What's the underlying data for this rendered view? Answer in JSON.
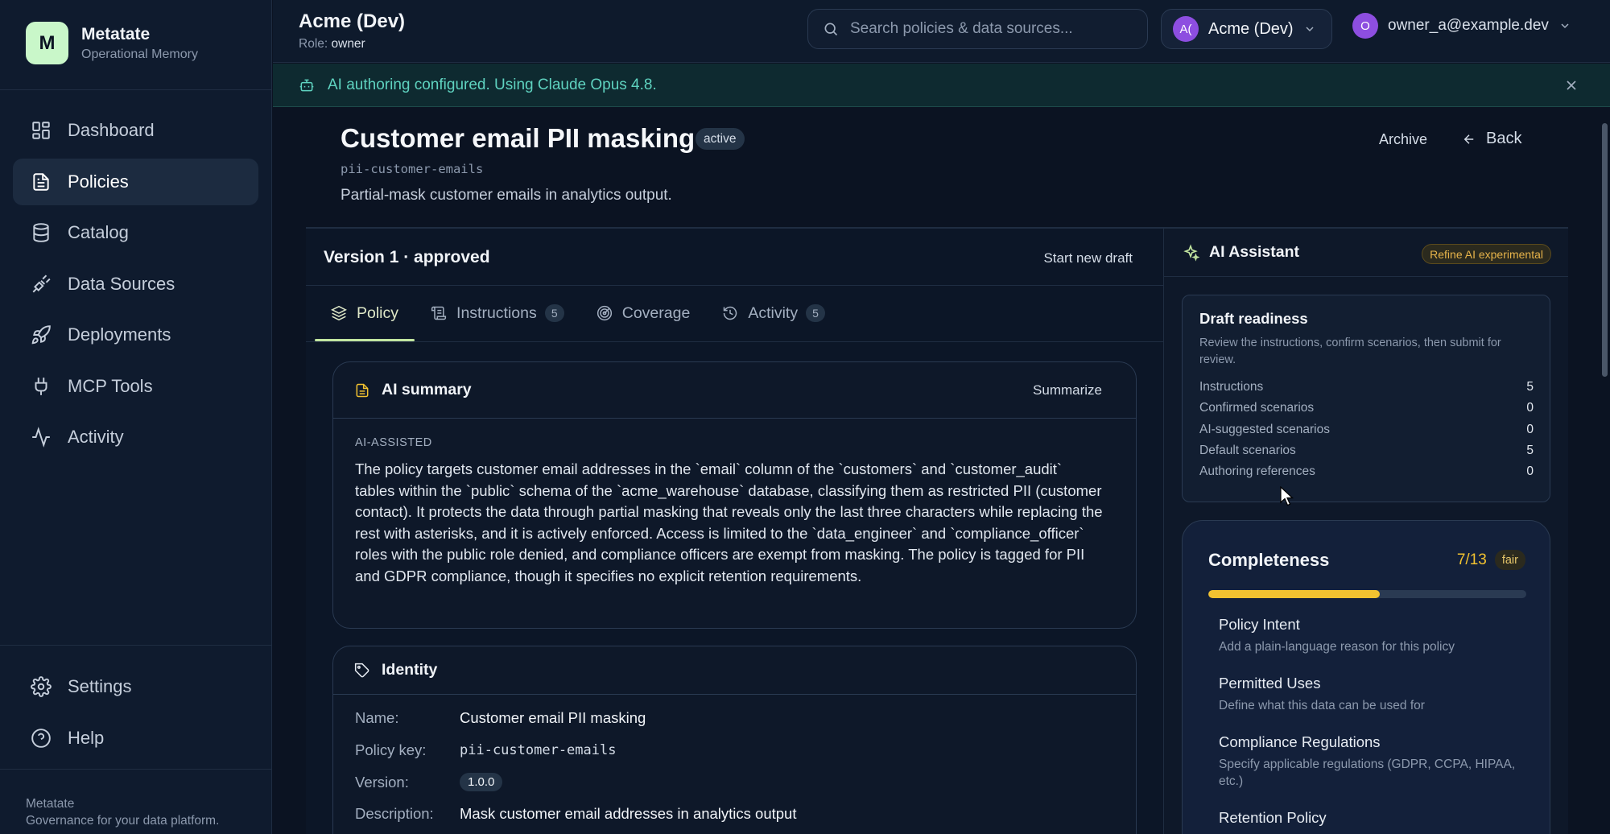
{
  "brand": {
    "initial": "M",
    "name": "Metatate",
    "subtitle": "Operational Memory"
  },
  "sidebar": {
    "items": [
      {
        "label": "Dashboard",
        "icon": "dashboard-icon"
      },
      {
        "label": "Policies",
        "icon": "document-icon",
        "active": true
      },
      {
        "label": "Catalog",
        "icon": "database-icon"
      },
      {
        "label": "Data Sources",
        "icon": "plug-icon"
      },
      {
        "label": "Deployments",
        "icon": "rocket-icon"
      },
      {
        "label": "MCP Tools",
        "icon": "connector-icon"
      },
      {
        "label": "Activity",
        "icon": "pulse-icon"
      }
    ],
    "bottom_items": [
      {
        "label": "Settings",
        "icon": "gear-icon"
      },
      {
        "label": "Help",
        "icon": "help-icon"
      }
    ],
    "footer_title": "Metatate",
    "footer_sub": "Governance for your data platform."
  },
  "header": {
    "org_title": "Acme (Dev)",
    "role_label": "Role:",
    "role_value": "owner",
    "search_placeholder": "Search policies & data sources...",
    "org_avatar": "A(",
    "org_name": "Acme (Dev)",
    "user_avatar": "O",
    "user_email": "owner_a@example.dev"
  },
  "banner": {
    "message": "AI authoring configured. Using Claude Opus 4.8."
  },
  "policy": {
    "title": "Customer email PII masking",
    "status": "active",
    "key": "pii-customer-emails",
    "description": "Partial-mask customer emails in analytics output.",
    "archive_label": "Archive",
    "back_label": "Back",
    "version_title": "Version 1 · approved",
    "new_draft_label": "Start new draft"
  },
  "tabs": [
    {
      "label": "Policy",
      "count": ""
    },
    {
      "label": "Instructions",
      "count": "5"
    },
    {
      "label": "Coverage",
      "count": ""
    },
    {
      "label": "Activity",
      "count": "5"
    }
  ],
  "ai_summary": {
    "title": "AI summary",
    "action": "Summarize",
    "tag": "AI-ASSISTED",
    "text": "The policy targets customer email addresses in the `email` column of the `customers` and `customer_audit` tables within the `public` schema of the `acme_warehouse` database, classifying them as restricted PII (customer contact). It protects the data through partial masking that reveals only the last three characters while replacing the rest with asterisks, and it is actively enforced. Access is limited to the `data_engineer` and `compliance_officer` roles with the public role denied, and compliance officers are exempt from masking. The policy is tagged for PII and GDPR compliance, though it specifies no explicit retention requirements."
  },
  "identity": {
    "title": "Identity",
    "rows": [
      {
        "key": "Name:",
        "value": "Customer email PII masking"
      },
      {
        "key": "Policy key:",
        "value": "pii-customer-emails"
      },
      {
        "key": "Version:",
        "value": "1.0.0"
      },
      {
        "key": "Description:",
        "value": "Mask customer email addresses in analytics output"
      }
    ]
  },
  "assistant": {
    "title": "AI Assistant",
    "badge": "Refine AI experimental",
    "readiness": {
      "title": "Draft readiness",
      "subtitle": "Review the instructions, confirm scenarios, then submit for review.",
      "rows": [
        {
          "label": "Instructions",
          "value": "5"
        },
        {
          "label": "Confirmed scenarios",
          "value": "0"
        },
        {
          "label": "AI-suggested scenarios",
          "value": "0"
        },
        {
          "label": "Default scenarios",
          "value": "5"
        },
        {
          "label": "Authoring references",
          "value": "0"
        }
      ]
    },
    "completeness": {
      "title": "Completeness",
      "score": "7/13",
      "rating": "fair",
      "progress_fraction": 0.538,
      "items": [
        {
          "title": "Policy Intent",
          "desc": "Add a plain-language reason for this policy"
        },
        {
          "title": "Permitted Uses",
          "desc": "Define what this data can be used for"
        },
        {
          "title": "Compliance Regulations",
          "desc": "Specify applicable regulations (GDPR, CCPA, HIPAA, etc.)"
        },
        {
          "title": "Retention Policy",
          "desc": ""
        }
      ]
    }
  }
}
